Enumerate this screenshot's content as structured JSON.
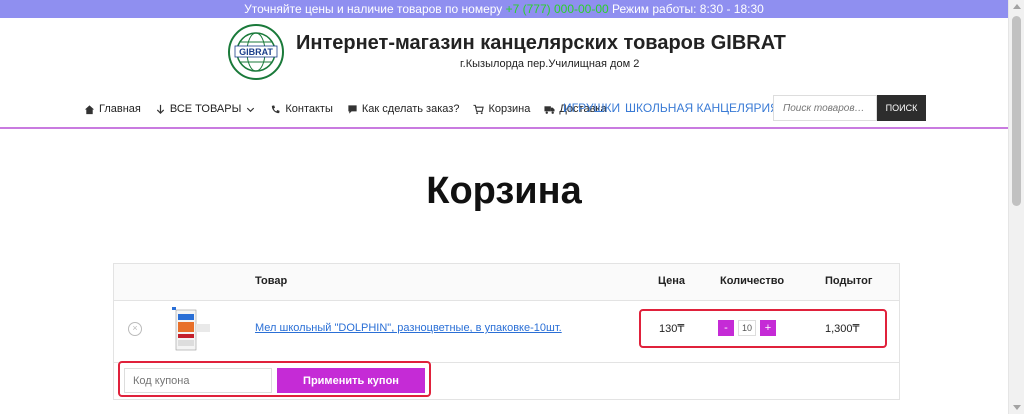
{
  "topbar": {
    "before": "Уточняйте цены и наличие товаров по номеру ",
    "phone": "+7 (777) 000-00-00",
    "after": " Режим работы: 8:30 - 18:30"
  },
  "header": {
    "logo_text": "GIBRAT",
    "title": "Интернет-магазин канцелярских товаров GIBRAT",
    "address": "г.Кызылорда пер.Училищная дом 2"
  },
  "nav": {
    "items": [
      {
        "label": "Главная",
        "icon": "home-icon"
      },
      {
        "label": "ВСЕ ТОВАРЫ",
        "icon": "arrow-down-icon"
      },
      {
        "label": "Контакты",
        "icon": "phone-icon"
      },
      {
        "label": "Как сделать заказ?",
        "icon": "comment-icon"
      },
      {
        "label": "Корзина",
        "icon": "cart-icon"
      },
      {
        "label": "Доставка",
        "icon": "truck-icon"
      }
    ],
    "toys": "ИГРУШКИ",
    "school": "ШКОЛЬНАЯ КАНЦЕЛЯРИЯ",
    "search_placeholder": "Поиск товаров…",
    "search_button": "ПОИСК"
  },
  "page": {
    "title": "Корзина"
  },
  "cart": {
    "headers": {
      "product": "Товар",
      "price": "Цена",
      "quantity": "Количество",
      "subtotal": "Подытог"
    },
    "items": [
      {
        "name": "Мел школьный \"DOLPHIN\", разноцветные, в упаковке-10шт.",
        "price": "130₸",
        "quantity": "10",
        "minus": "-",
        "plus": "+",
        "subtotal": "1,300₸",
        "remove": "×"
      }
    ],
    "coupon_placeholder": "Код купона",
    "coupon_button": "Применить купон"
  },
  "colors": {
    "accent": "#c52bd6",
    "topbar": "#8f8ff0",
    "link": "#2a6fd6",
    "highlight": "#e0213b"
  }
}
